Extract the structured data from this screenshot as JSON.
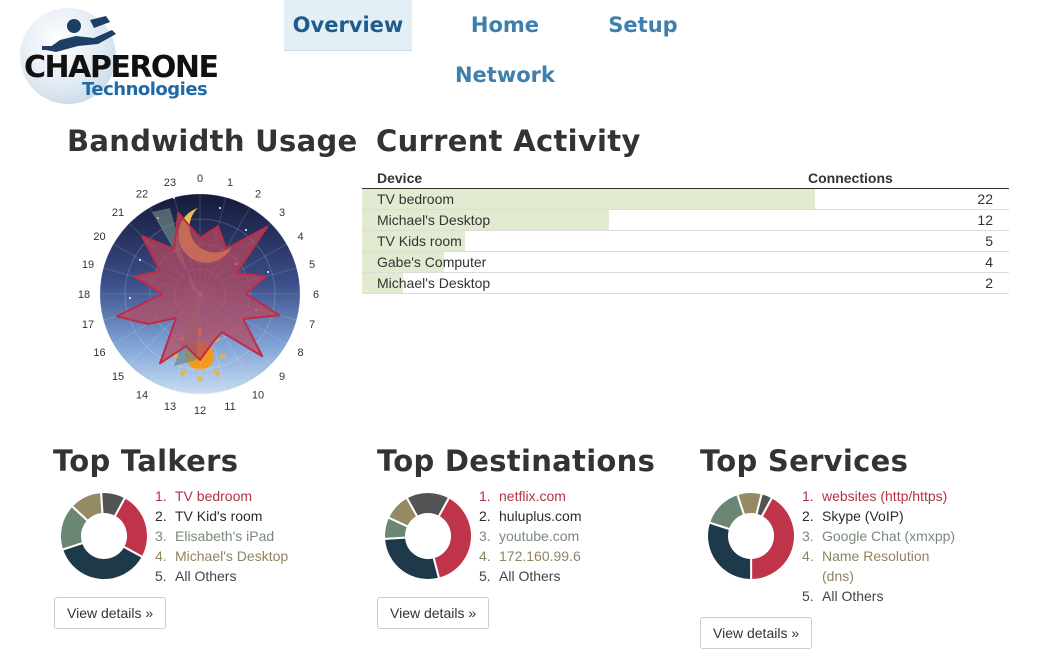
{
  "brand": {
    "name": "CHAPERONE",
    "sub": "Technologies"
  },
  "nav": [
    {
      "label": "Overview",
      "active": true
    },
    {
      "label": "Home Network",
      "active": false
    },
    {
      "label": "Setup",
      "active": false
    }
  ],
  "bandwidth": {
    "title": "Bandwidth Usage",
    "hours": [
      "0",
      "1",
      "2",
      "3",
      "4",
      "5",
      "6",
      "7",
      "8",
      "9",
      "10",
      "11",
      "12",
      "13",
      "14",
      "15",
      "16",
      "17",
      "18",
      "19",
      "20",
      "21",
      "22",
      "23"
    ],
    "values": [
      0.56,
      0.7,
      0.52,
      0.95,
      0.42,
      0.68,
      0.46,
      0.82,
      0.5,
      0.88,
      0.44,
      0.5,
      0.66,
      0.54,
      0.8,
      0.34,
      0.6,
      0.86,
      0.38,
      0.68,
      0.46,
      0.82,
      0.52,
      0.84
    ],
    "colors": {
      "fill": "#b8485e",
      "stroke": "#c02b47"
    }
  },
  "activity": {
    "title": "Current Activity",
    "col_device": "Device",
    "col_connections": "Connections",
    "max": 22,
    "rows": [
      {
        "device": "TV bedroom",
        "connections": 22
      },
      {
        "device": "Michael's Desktop",
        "connections": 12
      },
      {
        "device": "TV Kids room",
        "connections": 5
      },
      {
        "device": "Gabe's Computer",
        "connections": 4
      },
      {
        "device": "Michael's Desktop",
        "connections": 2
      }
    ]
  },
  "colors": {
    "c1": "#c0344a",
    "c2": "#1e3a4a",
    "c3": "#6b8774",
    "c4": "#958a63",
    "c5": "#545454"
  },
  "talkers": {
    "title": "Top Talkers",
    "items": [
      {
        "n": "1.",
        "label": "TV bedroom"
      },
      {
        "n": "2.",
        "label": "TV Kid's room"
      },
      {
        "n": "3.",
        "label": "Elisabeth's iPad"
      },
      {
        "n": "4.",
        "label": "Michael's Desktop"
      },
      {
        "n": "5.",
        "label": "All Others"
      }
    ],
    "shares": [
      25,
      37,
      17,
      12,
      9
    ],
    "details": "View details »"
  },
  "destinations": {
    "title": "Top Destinations",
    "items": [
      {
        "n": "1.",
        "label": "netflix.com"
      },
      {
        "n": "2.",
        "label": "huluplus.com"
      },
      {
        "n": "3.",
        "label": "youtube.com"
      },
      {
        "n": "4.",
        "label": "172.160.99.6"
      },
      {
        "n": "5.",
        "label": "All Others"
      }
    ],
    "shares": [
      38,
      28,
      8,
      10,
      16
    ],
    "details": "View details »"
  },
  "services": {
    "title": "Top Services",
    "items": [
      {
        "n": "1.",
        "label": "websites (http/https)"
      },
      {
        "n": "2.",
        "label": "Skype (VoIP)"
      },
      {
        "n": "3.",
        "label": "Google Chat (xmxpp)"
      },
      {
        "n": "4.",
        "label": "Name Resolution (dns)",
        "line1": "Name Resolution",
        "line2": "(dns)"
      },
      {
        "n": "5.",
        "label": "All Others"
      }
    ],
    "shares": [
      42,
      30,
      15,
      9,
      4
    ],
    "details": "View details »"
  }
}
